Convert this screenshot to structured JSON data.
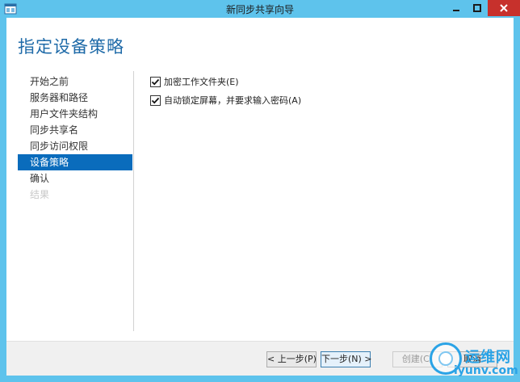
{
  "window": {
    "title": "新同步共享向导"
  },
  "page": {
    "title": "指定设备策略"
  },
  "nav": {
    "items": [
      {
        "label": "开始之前",
        "state": "normal"
      },
      {
        "label": "服务器和路径",
        "state": "normal"
      },
      {
        "label": "用户文件夹结构",
        "state": "normal"
      },
      {
        "label": "同步共享名",
        "state": "normal"
      },
      {
        "label": "同步访问权限",
        "state": "normal"
      },
      {
        "label": "设备策略",
        "state": "active"
      },
      {
        "label": "确认",
        "state": "normal"
      },
      {
        "label": "结果",
        "state": "disabled"
      }
    ]
  },
  "options": [
    {
      "label": "加密工作文件夹(E)",
      "checked": true
    },
    {
      "label": "自动锁定屏幕，并要求输入密码(A)",
      "checked": true
    }
  ],
  "footer": {
    "prev_label": "< 上一步(P)",
    "next_label": "下一步(N) >",
    "create_label": "创建(C)",
    "cancel_label": "取消"
  },
  "watermark": {
    "cn": "运维网",
    "en": "iyunv.com"
  },
  "colors": {
    "titlebar": "#5ec3ec",
    "accent": "#0a6cbc",
    "page_title": "#1e6aa8",
    "close": "#c7312c"
  },
  "icons": [
    "app-icon",
    "minimize-icon",
    "maximize-icon",
    "close-icon",
    "checkmark-icon"
  ]
}
